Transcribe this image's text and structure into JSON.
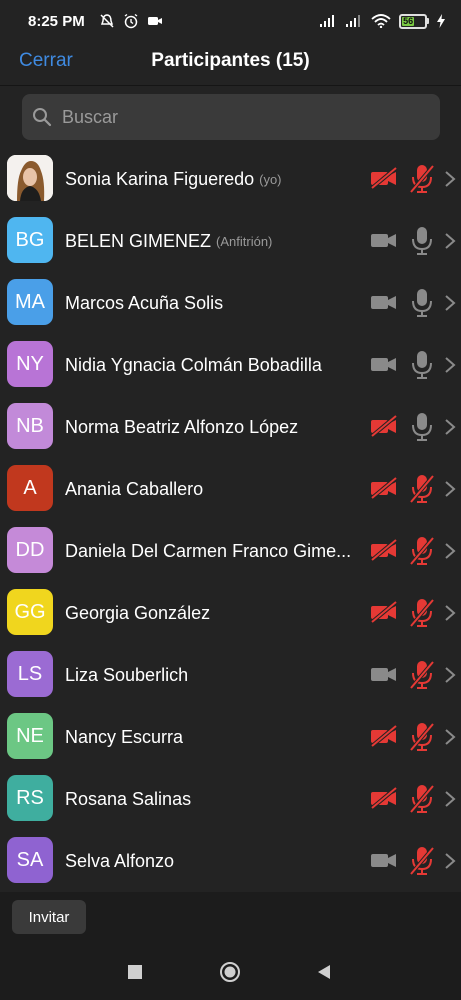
{
  "status_bar": {
    "time": "8:25 PM",
    "battery": "56",
    "icons": [
      "no-disturb-icon",
      "alarm-icon",
      "video-record-icon",
      "signal-icon",
      "signal-icon",
      "wifi-icon",
      "battery-icon",
      "charging-icon"
    ]
  },
  "header": {
    "close_label": "Cerrar",
    "title": "Participantes (15)"
  },
  "search": {
    "placeholder": "Buscar"
  },
  "colors": {
    "accent": "#3f8ae0",
    "muted_red": "#e53935",
    "icon_gray": "#8a8a8a"
  },
  "participants": [
    {
      "initials": "",
      "name": "Sonia Karina Figueredo",
      "tag": "(yo)",
      "avatar": "photo",
      "color": "#ffffff",
      "video_muted": true,
      "mic_muted": true
    },
    {
      "initials": "BG",
      "name": "BELEN GIMENEZ",
      "tag": "(Anfitrión)",
      "avatar": "initials",
      "color": "#4fb6f0",
      "video_muted": false,
      "mic_muted": false
    },
    {
      "initials": "MA",
      "name": "Marcos Acuña Solis",
      "tag": "",
      "avatar": "initials",
      "color": "#4a9fe8",
      "video_muted": false,
      "mic_muted": false
    },
    {
      "initials": "NY",
      "name": "Nidia Ygnacia Colmán Bobadilla",
      "tag": "",
      "avatar": "initials",
      "color": "#b874d6",
      "video_muted": false,
      "mic_muted": false
    },
    {
      "initials": "NB",
      "name": "Norma Beatriz Alfonzo López",
      "tag": "",
      "avatar": "initials",
      "color": "#c28ad9",
      "video_muted": true,
      "mic_muted": false
    },
    {
      "initials": "A",
      "name": "Anania Caballero",
      "tag": "",
      "avatar": "initials",
      "color": "#c1381e",
      "video_muted": true,
      "mic_muted": true
    },
    {
      "initials": "DD",
      "name": "Daniela Del Carmen Franco Gime...",
      "tag": "",
      "avatar": "initials",
      "color": "#c58ad8",
      "video_muted": true,
      "mic_muted": true
    },
    {
      "initials": "GG",
      "name": "Georgia González",
      "tag": "",
      "avatar": "initials",
      "color": "#f0d61e",
      "video_muted": true,
      "mic_muted": true
    },
    {
      "initials": "LS",
      "name": "Liza Souberlich",
      "tag": "",
      "avatar": "initials",
      "color": "#9b6bd3",
      "video_muted": false,
      "mic_muted": true
    },
    {
      "initials": "NE",
      "name": "Nancy Escurra",
      "tag": "",
      "avatar": "initials",
      "color": "#6cc784",
      "video_muted": true,
      "mic_muted": true
    },
    {
      "initials": "RS",
      "name": "Rosana Salinas",
      "tag": "",
      "avatar": "initials",
      "color": "#3fae9f",
      "video_muted": true,
      "mic_muted": true
    },
    {
      "initials": "SA",
      "name": "Selva Alfonzo",
      "tag": "",
      "avatar": "initials",
      "color": "#8f63d1",
      "video_muted": false,
      "mic_muted": true
    }
  ],
  "footer": {
    "invite_label": "Invitar"
  },
  "nav": {
    "icons": [
      "recent-apps-icon",
      "home-icon",
      "back-icon"
    ]
  }
}
